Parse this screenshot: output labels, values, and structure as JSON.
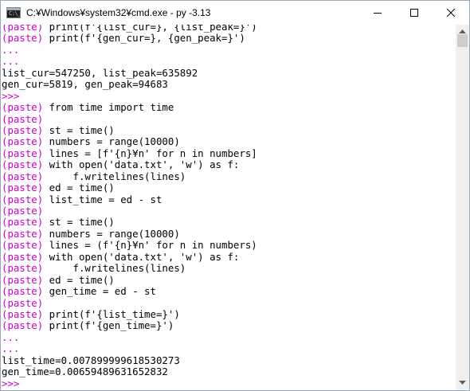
{
  "window": {
    "title": "C:¥Windows¥system32¥cmd.exe - py  -3.13",
    "app_icon_text": "C:\\_",
    "icons": {
      "minimize": "minimize-icon",
      "maximize": "maximize-icon",
      "close": "close-icon"
    }
  },
  "console": {
    "prompt_color": "#c800c8",
    "lines": [
      {
        "prompt": "(paste)",
        "text": " print(f'{list_cur=}, {list_peak=}')"
      },
      {
        "prompt": "(paste)",
        "text": " print(f'{gen_cur=}, {gen_peak=}')"
      },
      {
        "prompt": "...",
        "text": ""
      },
      {
        "prompt": "...",
        "text": ""
      },
      {
        "prompt": "",
        "text": "list_cur=547250, list_peak=635892"
      },
      {
        "prompt": "",
        "text": "gen_cur=5819, gen_peak=94683"
      },
      {
        "prompt": ">>>",
        "text": ""
      },
      {
        "prompt": "(paste)",
        "text": " from time import time"
      },
      {
        "prompt": "(paste)",
        "text": ""
      },
      {
        "prompt": "(paste)",
        "text": " st = time()"
      },
      {
        "prompt": "(paste)",
        "text": " numbers = range(10000)"
      },
      {
        "prompt": "(paste)",
        "text": " lines = [f'{n}¥n' for n in numbers]"
      },
      {
        "prompt": "(paste)",
        "text": " with open('data.txt', 'w') as f:"
      },
      {
        "prompt": "(paste)",
        "text": "     f.writelines(lines)"
      },
      {
        "prompt": "(paste)",
        "text": " ed = time()"
      },
      {
        "prompt": "(paste)",
        "text": " list_time = ed - st"
      },
      {
        "prompt": "(paste)",
        "text": ""
      },
      {
        "prompt": "(paste)",
        "text": " st = time()"
      },
      {
        "prompt": "(paste)",
        "text": " numbers = range(10000)"
      },
      {
        "prompt": "(paste)",
        "text": " lines = (f'{n}¥n' for n in numbers)"
      },
      {
        "prompt": "(paste)",
        "text": " with open('data.txt', 'w') as f:"
      },
      {
        "prompt": "(paste)",
        "text": "     f.writelines(lines)"
      },
      {
        "prompt": "(paste)",
        "text": " ed = time()"
      },
      {
        "prompt": "(paste)",
        "text": " gen_time = ed - st"
      },
      {
        "prompt": "(paste)",
        "text": ""
      },
      {
        "prompt": "(paste)",
        "text": " print(f'{list_time=}')"
      },
      {
        "prompt": "(paste)",
        "text": " print(f'{gen_time=}')"
      },
      {
        "prompt": "...",
        "text": ""
      },
      {
        "prompt": "...",
        "text": ""
      },
      {
        "prompt": "",
        "text": "list_time=0.007899999618530273"
      },
      {
        "prompt": "",
        "text": "gen_time=0.00659489631652832"
      },
      {
        "prompt": ">>>",
        "text": ""
      }
    ]
  },
  "scrollbar": {
    "up_icon": "scroll-up-arrow-icon",
    "down_icon": "scroll-down-arrow-icon"
  }
}
